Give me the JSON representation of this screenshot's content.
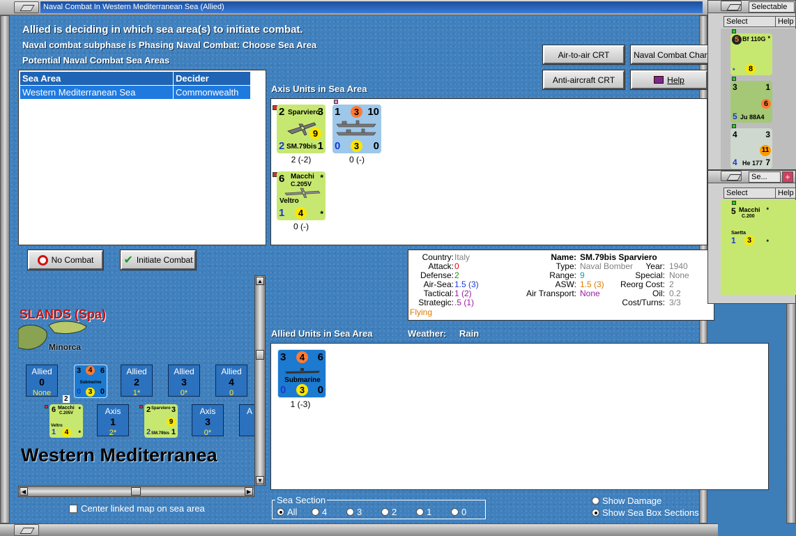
{
  "window": {
    "title": "Naval Combat In Western Mediterranean Sea (Allied)"
  },
  "status": {
    "line1": "Allied is deciding in which sea area(s) to initiate combat.",
    "line2": "Naval combat subphase is Phasing Naval Combat: Choose Sea Area",
    "line3": "Potential Naval Combat Sea Areas"
  },
  "sea_table": {
    "headers": [
      "Sea Area",
      "Decider"
    ],
    "rows": [
      {
        "area": "Western Mediterranean Sea",
        "decider": "Commonwealth"
      }
    ]
  },
  "buttons": {
    "air_to_air": "Air-to-air CRT",
    "naval_chart": "Naval Combat Chart",
    "anti_aircraft": "Anti-aircraft CRT",
    "help": "Help",
    "no_combat": "No Combat",
    "initiate_combat": "Initiate Combat"
  },
  "axis_section": {
    "title": "Axis Units in Sea Area",
    "units": [
      {
        "name": "Sparviero",
        "type": "SM.79bis",
        "tl": "2",
        "tr": "3",
        "bl": "2",
        "br": "1",
        "circle": "9",
        "caption": "2 (-2)"
      },
      {
        "name": "",
        "type": "",
        "tl": "1",
        "tc": "3",
        "tr": "10",
        "bl": "0",
        "br": "0",
        "circle": "3",
        "caption": "0 (-)"
      },
      {
        "name": "Macchi",
        "type": "C.205V",
        "sub": "Veltro",
        "tl": "6",
        "tr": "*",
        "bl": "1",
        "br": "*",
        "circle": "4",
        "caption": "0 (-)"
      }
    ]
  },
  "info": {
    "country_label": "Country:",
    "country": "Italy",
    "attack_label": "Attack:",
    "attack": "0",
    "defense_label": "Defense:",
    "defense": "2",
    "airsea_label": "Air-Sea:",
    "airsea": "1.5 (3)",
    "tactical_label": "Tactical:",
    "tactical": "1 (2)",
    "strategic_label": "Strategic:",
    "strategic": ".5 (1)",
    "flying": "Flying",
    "name_label": "Name:",
    "name": "SM.79bis Sparviero",
    "type_label": "Type:",
    "type": "Naval Bomber",
    "year_label": "Year:",
    "year": "1940",
    "range_label": "Range:",
    "range": "9",
    "special_label": "Special:",
    "special": "None",
    "asw_label": "ASW:",
    "asw": "1.5 (3)",
    "reorg_label": "Reorg Cost:",
    "reorg": "2",
    "air_transport_label": "Air Transport:",
    "air_transport": "None",
    "oil_label": "Oil:",
    "oil": "0.2",
    "cost_label": "Cost/Turns:",
    "cost": "3/3"
  },
  "allied_section": {
    "title": "Allied Units in Sea Area",
    "weather_label": "Weather:",
    "weather": "Rain",
    "units": [
      {
        "name": "Submarine",
        "tl": "3",
        "tc": "4",
        "tr": "6",
        "bl": "0",
        "br": "0",
        "circle": "3",
        "caption": "1 (-3)"
      }
    ]
  },
  "map": {
    "region_label": "SLANDS (Spa)",
    "island_label": "Minorca",
    "sea_label": "Western Mediterranea",
    "allied_boxes": [
      {
        "label": "Allied",
        "value": "0",
        "sub": "None"
      },
      {
        "label": "Allied",
        "value": "2",
        "sub": "1*"
      },
      {
        "label": "Allied",
        "value": "3",
        "sub": "0*"
      },
      {
        "label": "Allied",
        "value": "4",
        "sub": "0"
      }
    ],
    "axis_boxes": [
      {
        "label": "Axis",
        "value": "1",
        "sub": "2*"
      },
      {
        "label": "Axis",
        "value": "3",
        "sub": "0*"
      },
      {
        "label": "A"
      }
    ],
    "stack_count": "2",
    "mini_sub": {
      "tl": "3",
      "tc": "4",
      "tr": "6",
      "bl": "0",
      "br": "0",
      "circle": "3",
      "name": "Submarine"
    },
    "mini_macchi": {
      "tl": "6",
      "tr": "*",
      "bl": "1",
      "br": "*",
      "circle": "4",
      "name": "Macchi",
      "type": "C.205V",
      "sub": "Veltro"
    },
    "mini_sparv": {
      "tl": "2",
      "tr": "3",
      "bl": "2",
      "br": "1",
      "circle": "9",
      "name": "Sparviero",
      "type": "SM.79bis"
    }
  },
  "center_map_label": "Center linked map on sea area",
  "sea_section": {
    "title": "Sea Section",
    "options": [
      "All",
      "4",
      "3",
      "2",
      "1",
      "0"
    ],
    "selected": "All"
  },
  "display_options": {
    "show_damage": "Show Damage",
    "show_sea_box": "Show Sea Box Sections"
  },
  "side_panel_1": {
    "tab": "Selectable",
    "select": "Select",
    "help": "Help",
    "units": [
      {
        "tl": "5",
        "tr": "*",
        "name": "Bf 110G",
        "bl": "*",
        "circle": "8"
      },
      {
        "tl": "3",
        "tr": "1",
        "bl": "5",
        "name": "Ju 88A4",
        "circle": "6"
      },
      {
        "tl": "4",
        "tr": "3",
        "bl": "4",
        "name": "He 177",
        "br": "7",
        "circle": "11"
      }
    ]
  },
  "side_panel_2": {
    "tab": "Se...",
    "select": "Select",
    "help": "Help",
    "units": [
      {
        "tl": "5",
        "tr": "*",
        "name": "Macchi",
        "type": "C.200",
        "sub": "Saetta",
        "bl": "1",
        "br": "*",
        "circle": "3"
      }
    ]
  }
}
